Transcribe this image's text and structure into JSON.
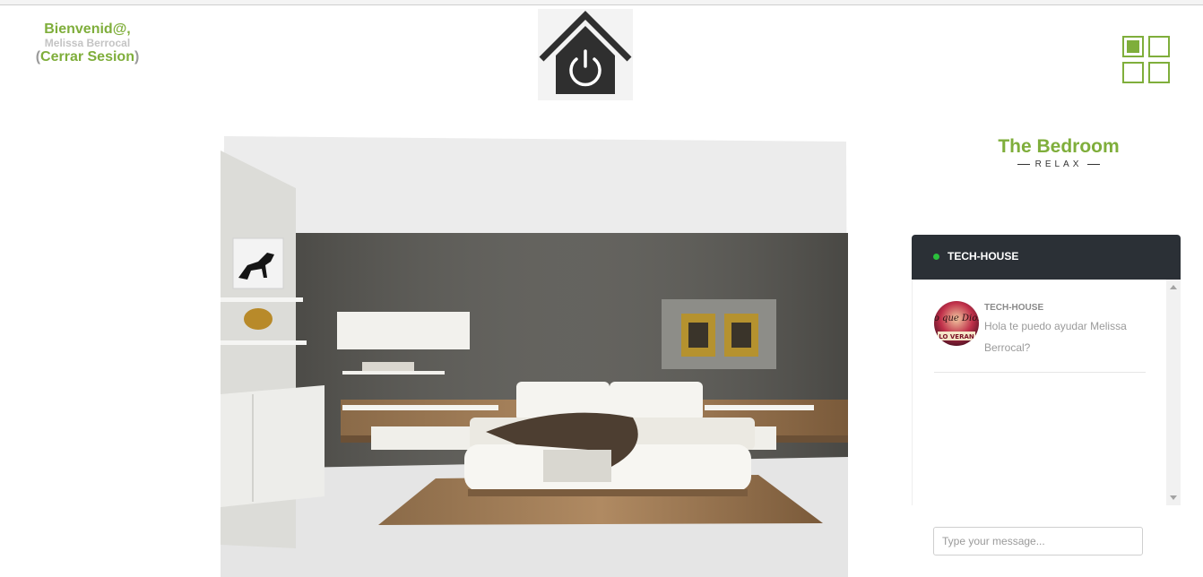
{
  "header": {
    "welcome": "Bienvenid@,",
    "user_name": "Melissa Berrocal",
    "logout_open": "(",
    "logout_label": "Cerrar Sesion",
    "logout_close": ")"
  },
  "logo": {
    "icon": "house-power-icon"
  },
  "layout_toggle": {
    "icon": "grid-view-icon",
    "active_cell": 1
  },
  "room": {
    "name": "The Bedroom",
    "tagline": "RELAX",
    "image": "bedroom-photo"
  },
  "chat": {
    "title": "TECH-HOUSE",
    "status_color": "#2bbf3c",
    "messages": [
      {
        "author": "TECH-HOUSE",
        "text": "Hola te puedo ayudar Melissa Berrocal?"
      }
    ],
    "input_placeholder": "Type your message..."
  },
  "colors": {
    "accent": "#7fae3b",
    "chat_header": "#2b3036"
  }
}
